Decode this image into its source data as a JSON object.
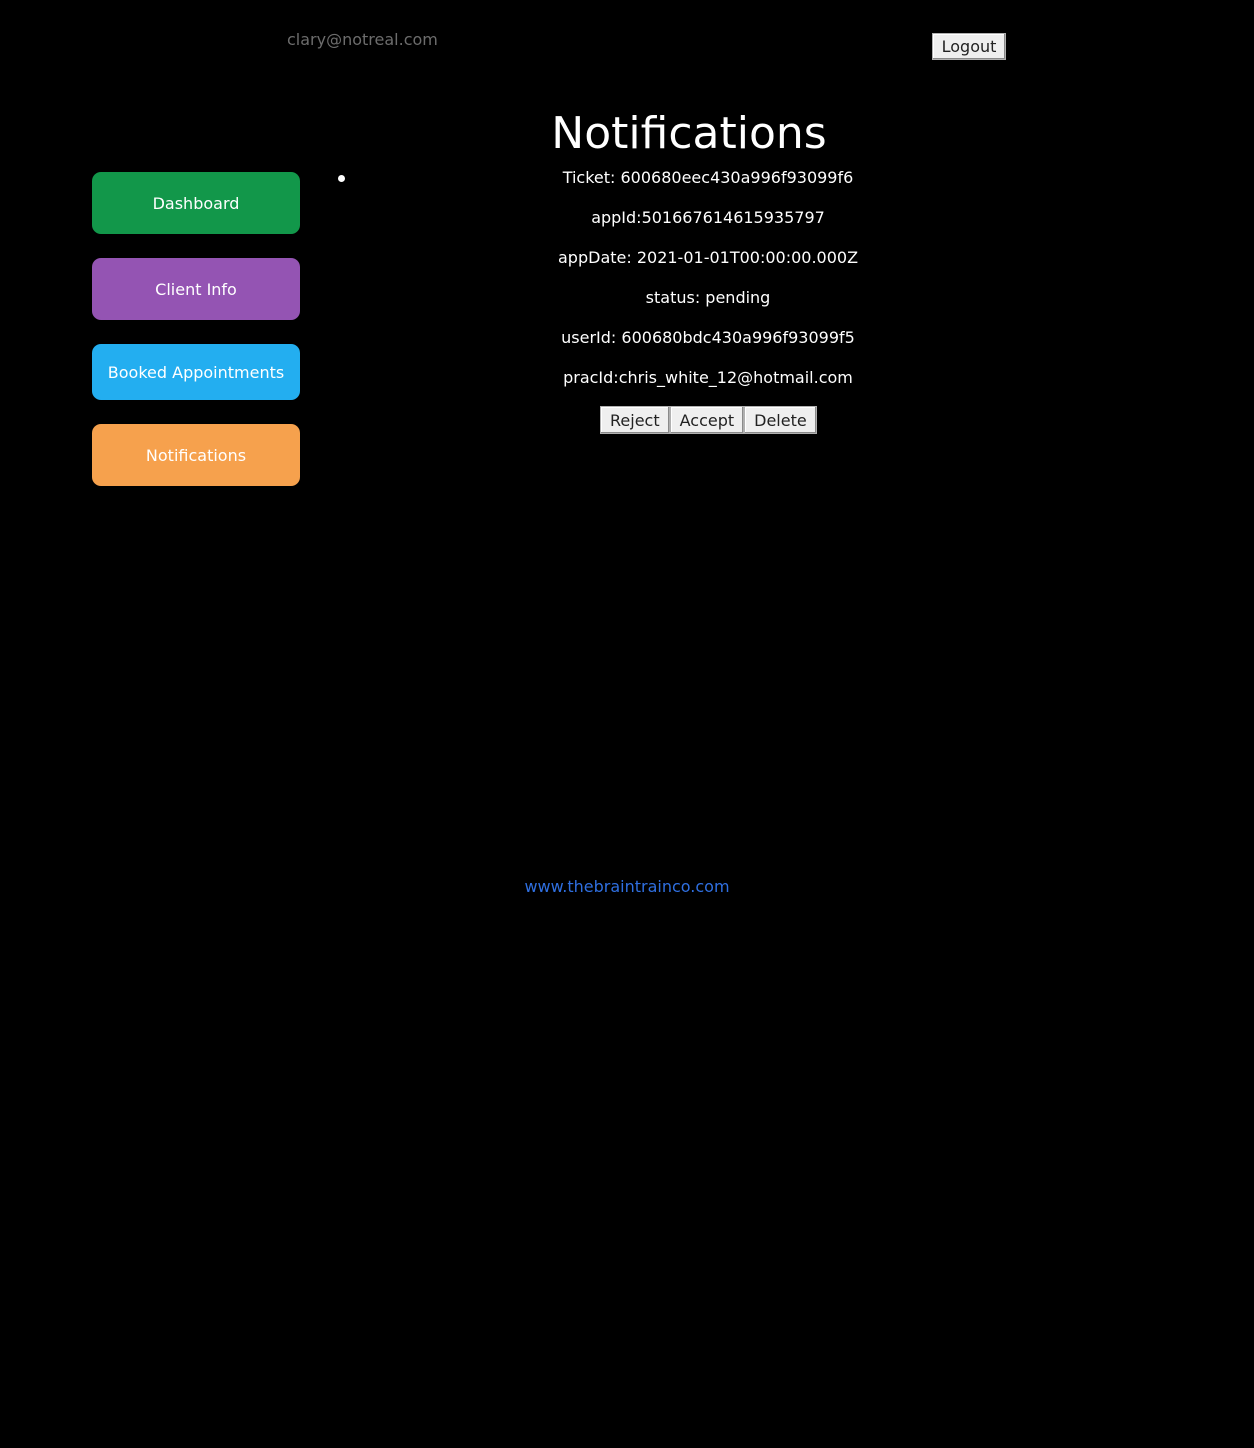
{
  "header": {
    "user_email": "clary@notreal.com",
    "logout_label": "Logout"
  },
  "sidebar": {
    "items": [
      {
        "label": "Dashboard",
        "color": "#12974a"
      },
      {
        "label": "Client Info",
        "color": "#9454b3"
      },
      {
        "label": "Booked Appointments",
        "color": "#23aef0"
      },
      {
        "label": "Notifications",
        "color": "#f6a14d"
      }
    ]
  },
  "main": {
    "title": "Notifications",
    "notification": {
      "ticket": "Ticket: 600680eec430a996f93099f6",
      "app_id": "appId:501667614615935797",
      "app_date": "appDate: 2021-01-01T00:00:00.000Z",
      "status": "status: pending",
      "user_id": "userId: 600680bdc430a996f93099f5",
      "prac_id": "pracId:chris_white_12@hotmail.com",
      "actions": {
        "reject_label": "Reject",
        "accept_label": "Accept",
        "delete_label": "Delete"
      }
    }
  },
  "footer": {
    "link_text": "www.thebraintrainco.com"
  }
}
